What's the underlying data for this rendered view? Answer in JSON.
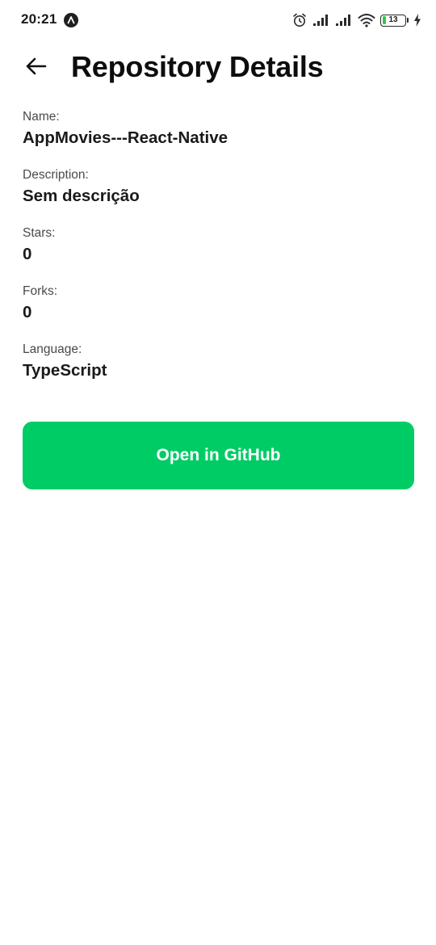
{
  "status_bar": {
    "time": "20:21",
    "battery_level": "13",
    "icons": [
      "app-badge-icon",
      "alarm-icon",
      "signal-icon",
      "signal-icon",
      "wifi-icon",
      "battery-icon",
      "charging-icon"
    ]
  },
  "header": {
    "back_icon": "arrow-left-icon",
    "title": "Repository Details"
  },
  "details": [
    {
      "label": "Name:",
      "value": "AppMovies---React-Native"
    },
    {
      "label": "Description:",
      "value": "Sem descrição"
    },
    {
      "label": "Stars:",
      "value": "0"
    },
    {
      "label": "Forks:",
      "value": "0"
    },
    {
      "label": "Language:",
      "value": "TypeScript"
    }
  ],
  "actions": {
    "open_label": "Open in GitHub"
  },
  "colors": {
    "accent": "#00cc66",
    "background": "#ffffff",
    "text_primary": "#1a1a1a",
    "text_secondary": "#4a4a4a",
    "battery_fill": "#2ec94a"
  }
}
